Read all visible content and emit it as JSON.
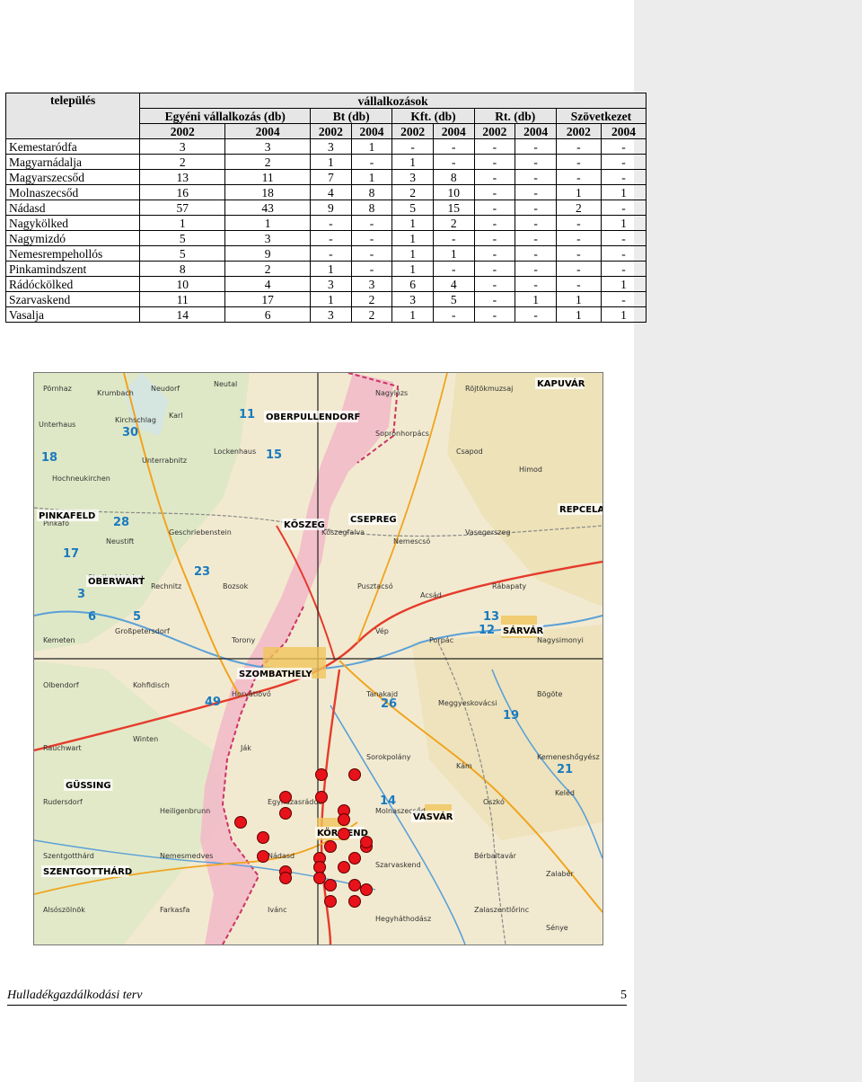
{
  "table": {
    "col_telepules": "település",
    "col_vallalkozasok": "vállalkozások",
    "groups": [
      "Egyéni vállalkozás (db)",
      "Bt (db)",
      "Kft. (db)",
      "Rt. (db)",
      "Szövetkezet"
    ],
    "years": [
      "2002",
      "2004",
      "2002",
      "2004",
      "2002",
      "2004",
      "2002",
      "2004",
      "2002",
      "2004"
    ],
    "rows": [
      {
        "name": "Kemestaródfa",
        "values": [
          "3",
          "3",
          "3",
          "1",
          "-",
          "-",
          "-",
          "-",
          "-",
          "-"
        ]
      },
      {
        "name": "Magyarnádalja",
        "values": [
          "2",
          "2",
          "1",
          "-",
          "1",
          "-",
          "-",
          "-",
          "-",
          "-"
        ]
      },
      {
        "name": "Magyarszecsőd",
        "values": [
          "13",
          "11",
          "7",
          "1",
          "3",
          "8",
          "-",
          "-",
          "-",
          "-"
        ]
      },
      {
        "name": "Molnaszecsőd",
        "values": [
          "16",
          "18",
          "4",
          "8",
          "2",
          "10",
          "-",
          "-",
          "1",
          "1"
        ]
      },
      {
        "name": "Nádasd",
        "values": [
          "57",
          "43",
          "9",
          "8",
          "5",
          "15",
          "-",
          "-",
          "2",
          "-"
        ]
      },
      {
        "name": "Nagykölked",
        "values": [
          "1",
          "1",
          "-",
          "-",
          "1",
          "2",
          "-",
          "-",
          "-",
          "1"
        ]
      },
      {
        "name": "Nagymizdó",
        "values": [
          "5",
          "3",
          "-",
          "-",
          "1",
          "-",
          "-",
          "-",
          "-",
          "-"
        ]
      },
      {
        "name": "Nemesrempehollós",
        "values": [
          "5",
          "9",
          "-",
          "-",
          "1",
          "1",
          "-",
          "-",
          "-",
          "-"
        ]
      },
      {
        "name": "Pinkamindszent",
        "values": [
          "8",
          "2",
          "1",
          "-",
          "1",
          "-",
          "-",
          "-",
          "-",
          "-"
        ]
      },
      {
        "name": "Rádóckölked",
        "values": [
          "10",
          "4",
          "3",
          "3",
          "6",
          "4",
          "-",
          "-",
          "-",
          "1"
        ]
      },
      {
        "name": "Szarvaskend",
        "values": [
          "11",
          "17",
          "1",
          "2",
          "3",
          "5",
          "-",
          "1",
          "1",
          "-"
        ]
      },
      {
        "name": "Vasalja",
        "values": [
          "14",
          "6",
          "3",
          "2",
          "1",
          "-",
          "-",
          "-",
          "1",
          "1"
        ]
      }
    ]
  },
  "map": {
    "cities": [
      "KAPUVÁR",
      "OBERPULLENDORF",
      "KŐSZEG",
      "CSEPREG",
      "PINKAFELD",
      "OBERWART",
      "SZOMBATHELY",
      "SÁRVÁR",
      "KÖRMEND",
      "VASVÁR",
      "GÜSSING",
      "SZENTGOTTHÁRD",
      "REPCELAK"
    ],
    "grid_numbers": [
      "11",
      "15",
      "30",
      "28",
      "17",
      "13",
      "23",
      "26",
      "19",
      "21",
      "14",
      "12",
      "49",
      "18",
      "5",
      "6",
      "3"
    ],
    "marker_color": "#e8121a"
  },
  "footer": {
    "title": "Hulladékgazdálkodási terv",
    "page": "5"
  }
}
